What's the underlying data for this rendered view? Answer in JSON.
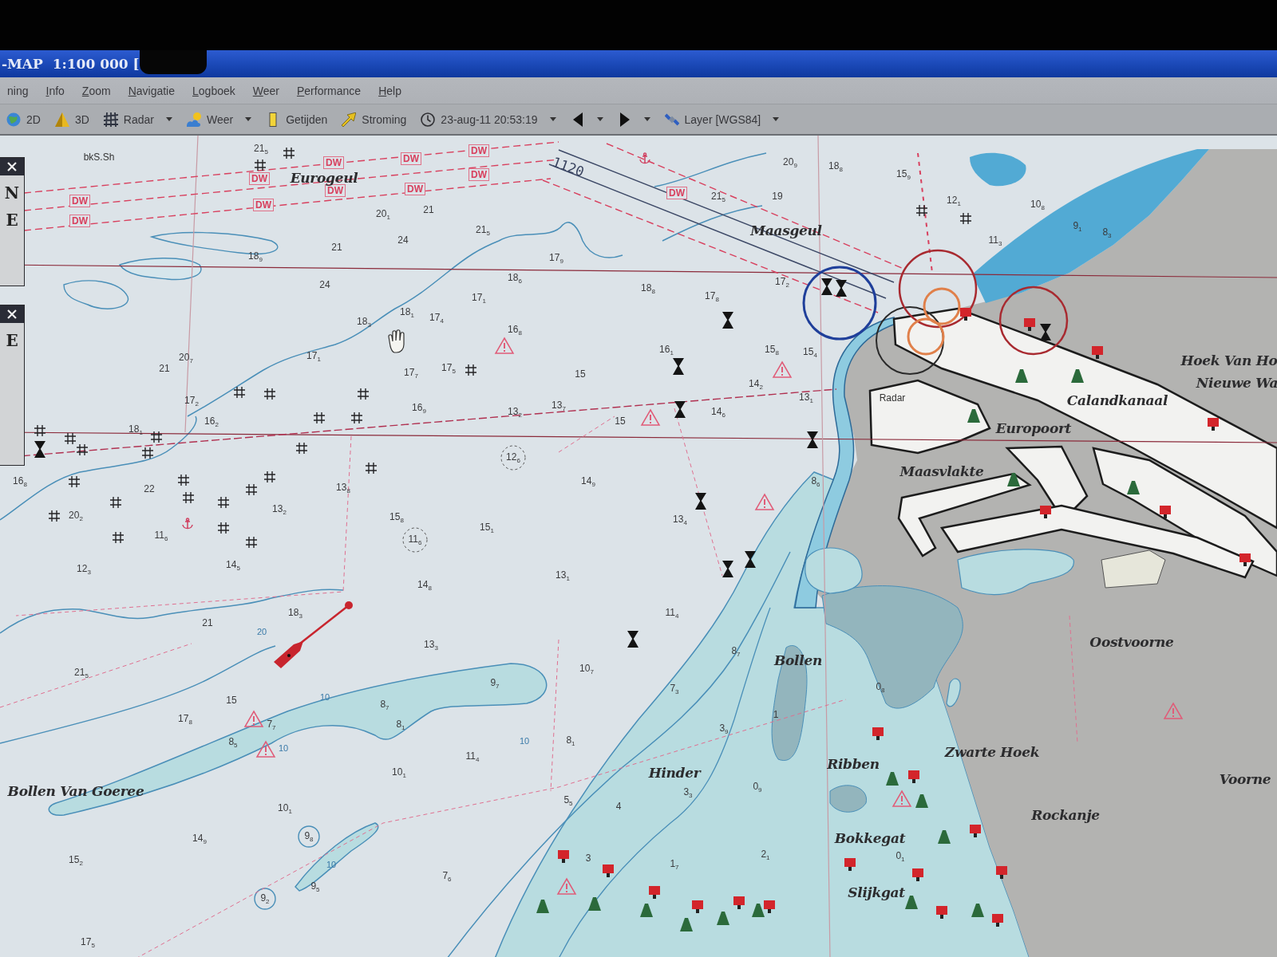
{
  "title_bar": {
    "title": "-MAP  1:100 000 ["
  },
  "menu": [
    "ning",
    "Info",
    "Zoom",
    "Navigatie",
    "Logboek",
    "Weer",
    "Performance",
    "Help"
  ],
  "toolbar": [
    {
      "label": "2D",
      "dropdown": false
    },
    {
      "label": "3D",
      "dropdown": false
    },
    {
      "label": "Radar",
      "dropdown": true
    },
    {
      "label": "Weer",
      "dropdown": true
    },
    {
      "label": "Getijden",
      "dropdown": false
    },
    {
      "label": "Stroming",
      "dropdown": false
    },
    {
      "label": "23-aug-11 20:53:19",
      "dropdown": true
    },
    {
      "dropdown": true
    },
    {
      "dropdown": true
    },
    {
      "label": "Layer [WGS84]",
      "dropdown": true
    }
  ],
  "side_panels": [
    {
      "letters": [
        "N",
        "E"
      ]
    },
    {
      "letters": [
        "E"
      ]
    }
  ],
  "chart": {
    "place_names": [
      "Eurogeul",
      "Maasgeul",
      "Maasvlakte",
      "Hoek Van Ho",
      "Nieuwe Wa",
      "Calandkanaal",
      "Europoort",
      "Oostvoorne",
      "Bollen",
      "Zwarte Hoek",
      "Voorne",
      "Rockanje",
      "Hinder",
      "Ribben",
      "Bokkegat",
      "Slijkgat",
      "Bollen Van Goeree"
    ],
    "labels": [
      "Radar",
      "bkS.Sh",
      "1120"
    ],
    "lane_labels": [
      "DW",
      "DW",
      "DW",
      "DW",
      "DW",
      "DW",
      "DW",
      "DW",
      "DW",
      "DW",
      "DW"
    ],
    "contour_labels": [
      "10",
      "10",
      "10",
      "10",
      "20"
    ],
    "soundings": [
      "21$_{5}$",
      "20$_{1}$",
      "21",
      "21$_{5}$",
      "24",
      "21",
      "18$_{9}$",
      "24",
      "18$_{1}$",
      "17$_{4}$",
      "18$_{3}$",
      "17$_{9}$",
      "18$_{6}$",
      "17$_{1}$",
      "16$_{8}$",
      "17$_{1}$",
      "21",
      "20$_{7}$",
      "17$_{7}$",
      "17$_{5}$",
      "15",
      "16$_{9}$",
      "13$_{2}$",
      "13$_{7}$",
      "17$_{2}$",
      "16$_{2}$",
      "18$_{1}$",
      "20$_{9}$",
      "18$_{8}$",
      "15$_{9}$",
      "21$_{5}$",
      "19",
      "12$_{1}$",
      "10$_{8}$",
      "11$_{3}$",
      "9$_{1}$",
      "8$_{3}$",
      "17$_{2}$",
      "17$_{8}$",
      "16$_{1}$",
      "15$_{8}$",
      "15$_{4}$",
      "14$_{2}$",
      "13$_{1}$",
      "14$_{6}$",
      "18$_{8}$",
      "16$_{8}$",
      "20$_{2}$",
      "11$_{6}$",
      "13$_{2}$",
      "13$_{8}$",
      "15$_{8}$",
      "15$_{1}$",
      "11$_{6}$",
      "14$_{9}$",
      "12$_{3}$",
      "14$_{5}$",
      "14$_{8}$",
      "13$_{1}$",
      "18$_{3}$",
      "21",
      "13$_{3}$",
      "10$_{7}$",
      "21$_{5}$",
      "15",
      "17$_{8}$",
      "9$_{7}$",
      "8$_{7}$",
      "8$_{1}$",
      "7$_{7}$",
      "8$_{5}$",
      "11$_{4}$",
      "10$_{1}$",
      "8$_{1}$",
      "10$_{1}$",
      "14$_{9}$",
      "15$_{2}$",
      "9$_{8}$",
      "9$_{5}$",
      "9$_{2}$",
      "7$_{6}$",
      "5$_{5}$",
      "4",
      "3",
      "17$_{5}$",
      "8$_{6}$",
      "13$_{4}$",
      "11$_{4}$",
      "8$_{7}$",
      "7$_{3}$",
      "3$_{9}$",
      "3$_{3}$",
      "0$_{9}$",
      "1$_{7}$",
      "2$_{1}$",
      "0$_{8}$",
      "0$_{1}$",
      "1",
      "15",
      "12$_{6}$",
      "22"
    ]
  }
}
